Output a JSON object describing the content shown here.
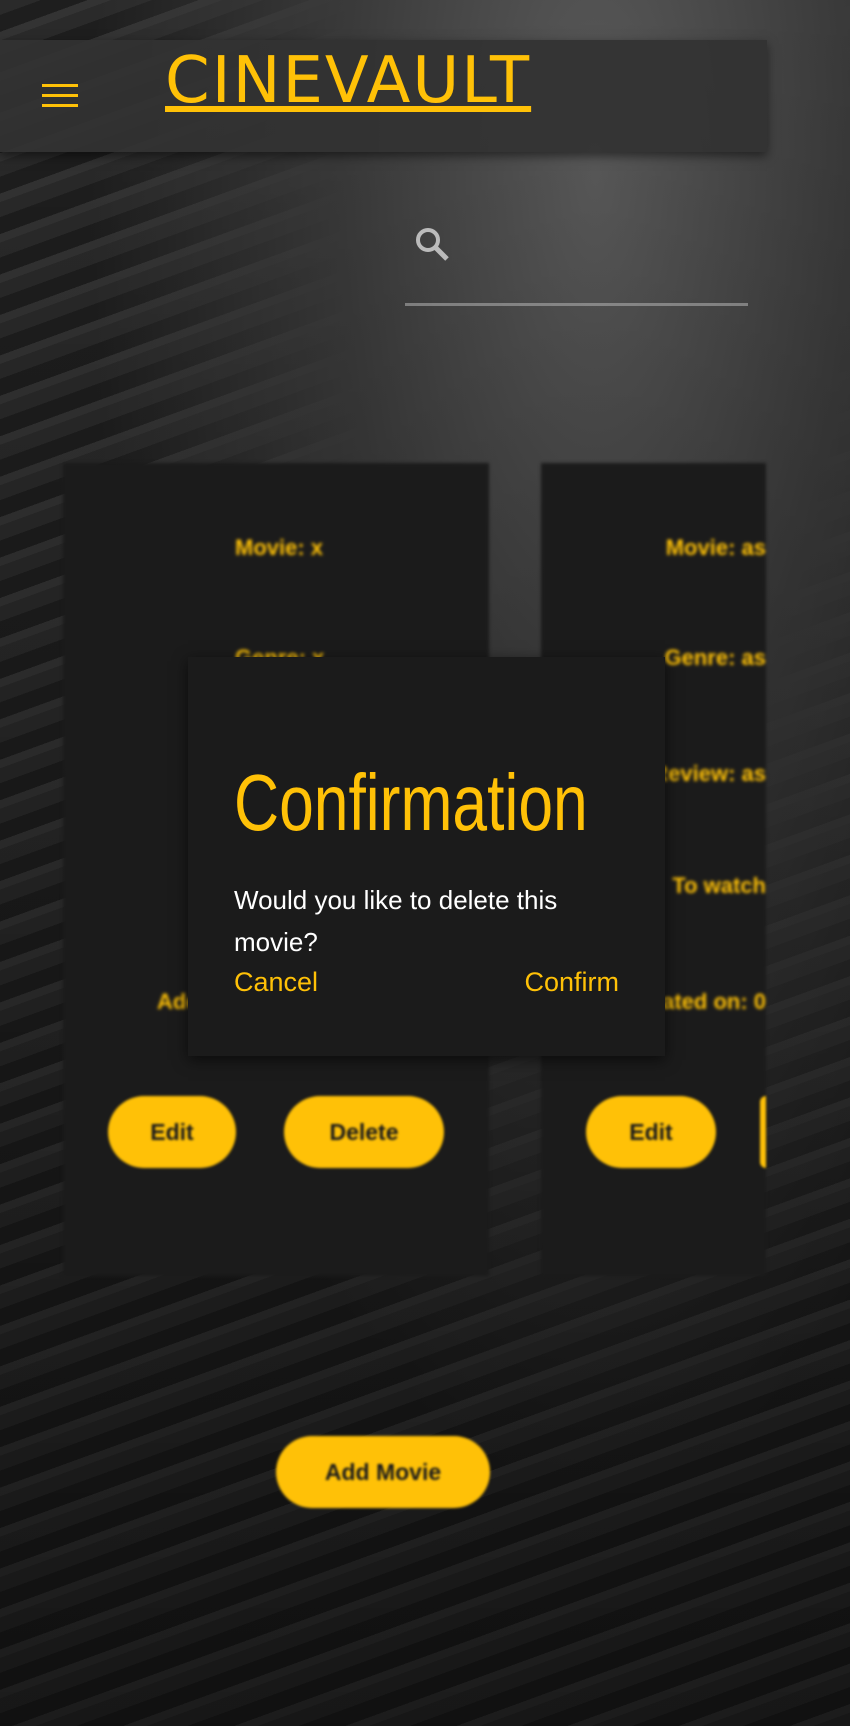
{
  "header": {
    "title": "CINEVAULT",
    "menu_icon": "hamburger-icon"
  },
  "search": {
    "icon": "search-icon"
  },
  "cards": [
    {
      "movie": "Movie: x",
      "genre": "Genre: x",
      "added": "Added on:",
      "edit": "Edit",
      "delete": "Delete"
    },
    {
      "movie": "Movie: as",
      "genre": "Genre: as",
      "review": "Review: as",
      "to_watch": "To watch",
      "updated": "Updated on: 0",
      "edit": "Edit"
    }
  ],
  "add_movie": "Add Movie",
  "dialog": {
    "title": "Confirmation",
    "message": "Would you like to delete this movie?",
    "cancel": "Cancel",
    "confirm": "Confirm"
  },
  "colors": {
    "accent": "#ffc107",
    "card": "#1b1b1b"
  }
}
